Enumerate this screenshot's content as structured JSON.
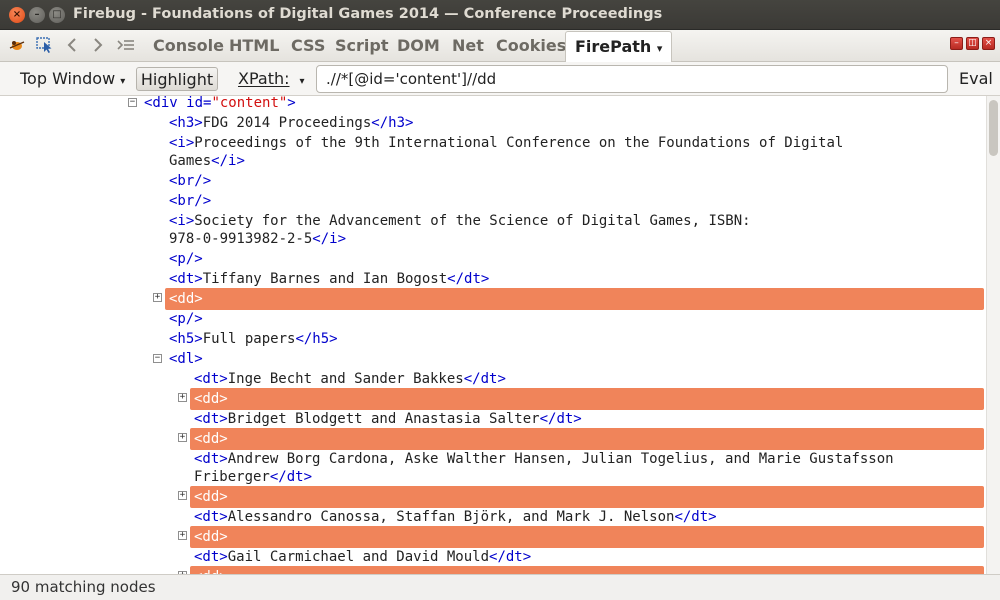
{
  "window": {
    "title": "Firebug - Foundations of Digital Games 2014 — Conference Proceedings",
    "close_glyph": "×",
    "min_glyph": "–",
    "max_glyph": "□"
  },
  "toolbar": {
    "tabs": [
      "Console",
      "HTML",
      "CSS",
      "Script",
      "DOM",
      "Net",
      "Cookies"
    ],
    "active_tab": "FirePath",
    "dropdown_glyph": "▾"
  },
  "firepath": {
    "context_label": "Top Window",
    "highlight_label": "Highlight",
    "xpath_label": "XPath:",
    "xpath_value": ".//*[@id='content']//dd",
    "eval_label": "Eval"
  },
  "tree": {
    "div_open": "<div",
    "div_attr_name": " id=",
    "div_attr_value": "\"content\"",
    "div_close_bracket": ">",
    "h3_open": "<h3>",
    "h3_text": "FDG 2014 Proceedings",
    "h3_close": "</h3>",
    "i_open": "<i>",
    "i1_text_a": "Proceedings of the 9th International Conference on the Foundations of Digital",
    "i1_text_b": "Games",
    "i_close": "</i>",
    "br": "<br/>",
    "i2_text_a": "Society for the Advancement of the Science of Digital Games, ISBN:",
    "i2_text_b": "978-0-9913982-2-5",
    "p": "<p/>",
    "dt_open": "<dt>",
    "dt_close": "</dt>",
    "dt_editors": "Tiffany Barnes and Ian Bogost",
    "dd": "<dd>",
    "h5_open": "<h5>",
    "h5_text": "Full papers",
    "h5_close": "</h5>",
    "dl_open": "<dl>",
    "dt_1": "Inge Becht and Sander Bakkes",
    "dt_2": "Bridget Blodgett and Anastasia Salter",
    "dt_3a": "Andrew Borg Cardona, Aske Walther Hansen, Julian Togelius, and Marie Gustafsson",
    "dt_3b": "Friberger",
    "dt_4": "Alessandro Canossa, Staffan Björk, and Mark J. Nelson",
    "dt_5": "Gail Carmichael and David Mould",
    "expand_glyph": "+",
    "collapse_glyph": "−"
  },
  "status": {
    "text": "90 matching nodes"
  },
  "colors": {
    "highlight": "#f0845a",
    "tag": "#0000cc",
    "attr_value": "#d21010"
  }
}
